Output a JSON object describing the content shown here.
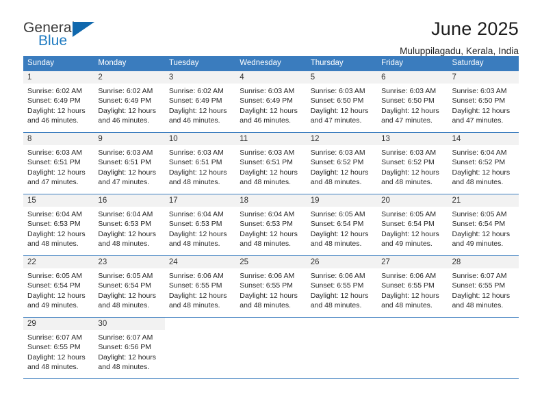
{
  "logo": {
    "primary_text": "General",
    "secondary_text": "Blue",
    "primary_color": "#3a3a3a",
    "secondary_color": "#1f7bc1",
    "triangle_color": "#1068ad",
    "icon": "triangle-icon"
  },
  "header": {
    "title": "June 2025",
    "subtitle": "Muluppilagadu, Kerala, India"
  },
  "theme": {
    "header_row_bg": "#3a7cbe",
    "header_row_text": "#ffffff",
    "row_separator": "#3a7cbe",
    "day_band_bg": "#f2f2f2",
    "body_text": "#262626"
  },
  "calendar": {
    "weekdays": [
      "Sunday",
      "Monday",
      "Tuesday",
      "Wednesday",
      "Thursday",
      "Friday",
      "Saturday"
    ],
    "weeks": [
      [
        {
          "day": "1",
          "sunrise": "Sunrise: 6:02 AM",
          "sunset": "Sunset: 6:49 PM",
          "daylight_line1": "Daylight: 12 hours",
          "daylight_line2": "and 46 minutes."
        },
        {
          "day": "2",
          "sunrise": "Sunrise: 6:02 AM",
          "sunset": "Sunset: 6:49 PM",
          "daylight_line1": "Daylight: 12 hours",
          "daylight_line2": "and 46 minutes."
        },
        {
          "day": "3",
          "sunrise": "Sunrise: 6:02 AM",
          "sunset": "Sunset: 6:49 PM",
          "daylight_line1": "Daylight: 12 hours",
          "daylight_line2": "and 46 minutes."
        },
        {
          "day": "4",
          "sunrise": "Sunrise: 6:03 AM",
          "sunset": "Sunset: 6:49 PM",
          "daylight_line1": "Daylight: 12 hours",
          "daylight_line2": "and 46 minutes."
        },
        {
          "day": "5",
          "sunrise": "Sunrise: 6:03 AM",
          "sunset": "Sunset: 6:50 PM",
          "daylight_line1": "Daylight: 12 hours",
          "daylight_line2": "and 47 minutes."
        },
        {
          "day": "6",
          "sunrise": "Sunrise: 6:03 AM",
          "sunset": "Sunset: 6:50 PM",
          "daylight_line1": "Daylight: 12 hours",
          "daylight_line2": "and 47 minutes."
        },
        {
          "day": "7",
          "sunrise": "Sunrise: 6:03 AM",
          "sunset": "Sunset: 6:50 PM",
          "daylight_line1": "Daylight: 12 hours",
          "daylight_line2": "and 47 minutes."
        }
      ],
      [
        {
          "day": "8",
          "sunrise": "Sunrise: 6:03 AM",
          "sunset": "Sunset: 6:51 PM",
          "daylight_line1": "Daylight: 12 hours",
          "daylight_line2": "and 47 minutes."
        },
        {
          "day": "9",
          "sunrise": "Sunrise: 6:03 AM",
          "sunset": "Sunset: 6:51 PM",
          "daylight_line1": "Daylight: 12 hours",
          "daylight_line2": "and 47 minutes."
        },
        {
          "day": "10",
          "sunrise": "Sunrise: 6:03 AM",
          "sunset": "Sunset: 6:51 PM",
          "daylight_line1": "Daylight: 12 hours",
          "daylight_line2": "and 48 minutes."
        },
        {
          "day": "11",
          "sunrise": "Sunrise: 6:03 AM",
          "sunset": "Sunset: 6:51 PM",
          "daylight_line1": "Daylight: 12 hours",
          "daylight_line2": "and 48 minutes."
        },
        {
          "day": "12",
          "sunrise": "Sunrise: 6:03 AM",
          "sunset": "Sunset: 6:52 PM",
          "daylight_line1": "Daylight: 12 hours",
          "daylight_line2": "and 48 minutes."
        },
        {
          "day": "13",
          "sunrise": "Sunrise: 6:03 AM",
          "sunset": "Sunset: 6:52 PM",
          "daylight_line1": "Daylight: 12 hours",
          "daylight_line2": "and 48 minutes."
        },
        {
          "day": "14",
          "sunrise": "Sunrise: 6:04 AM",
          "sunset": "Sunset: 6:52 PM",
          "daylight_line1": "Daylight: 12 hours",
          "daylight_line2": "and 48 minutes."
        }
      ],
      [
        {
          "day": "15",
          "sunrise": "Sunrise: 6:04 AM",
          "sunset": "Sunset: 6:53 PM",
          "daylight_line1": "Daylight: 12 hours",
          "daylight_line2": "and 48 minutes."
        },
        {
          "day": "16",
          "sunrise": "Sunrise: 6:04 AM",
          "sunset": "Sunset: 6:53 PM",
          "daylight_line1": "Daylight: 12 hours",
          "daylight_line2": "and 48 minutes."
        },
        {
          "day": "17",
          "sunrise": "Sunrise: 6:04 AM",
          "sunset": "Sunset: 6:53 PM",
          "daylight_line1": "Daylight: 12 hours",
          "daylight_line2": "and 48 minutes."
        },
        {
          "day": "18",
          "sunrise": "Sunrise: 6:04 AM",
          "sunset": "Sunset: 6:53 PM",
          "daylight_line1": "Daylight: 12 hours",
          "daylight_line2": "and 48 minutes."
        },
        {
          "day": "19",
          "sunrise": "Sunrise: 6:05 AM",
          "sunset": "Sunset: 6:54 PM",
          "daylight_line1": "Daylight: 12 hours",
          "daylight_line2": "and 48 minutes."
        },
        {
          "day": "20",
          "sunrise": "Sunrise: 6:05 AM",
          "sunset": "Sunset: 6:54 PM",
          "daylight_line1": "Daylight: 12 hours",
          "daylight_line2": "and 49 minutes."
        },
        {
          "day": "21",
          "sunrise": "Sunrise: 6:05 AM",
          "sunset": "Sunset: 6:54 PM",
          "daylight_line1": "Daylight: 12 hours",
          "daylight_line2": "and 49 minutes."
        }
      ],
      [
        {
          "day": "22",
          "sunrise": "Sunrise: 6:05 AM",
          "sunset": "Sunset: 6:54 PM",
          "daylight_line1": "Daylight: 12 hours",
          "daylight_line2": "and 49 minutes."
        },
        {
          "day": "23",
          "sunrise": "Sunrise: 6:05 AM",
          "sunset": "Sunset: 6:54 PM",
          "daylight_line1": "Daylight: 12 hours",
          "daylight_line2": "and 48 minutes."
        },
        {
          "day": "24",
          "sunrise": "Sunrise: 6:06 AM",
          "sunset": "Sunset: 6:55 PM",
          "daylight_line1": "Daylight: 12 hours",
          "daylight_line2": "and 48 minutes."
        },
        {
          "day": "25",
          "sunrise": "Sunrise: 6:06 AM",
          "sunset": "Sunset: 6:55 PM",
          "daylight_line1": "Daylight: 12 hours",
          "daylight_line2": "and 48 minutes."
        },
        {
          "day": "26",
          "sunrise": "Sunrise: 6:06 AM",
          "sunset": "Sunset: 6:55 PM",
          "daylight_line1": "Daylight: 12 hours",
          "daylight_line2": "and 48 minutes."
        },
        {
          "day": "27",
          "sunrise": "Sunrise: 6:06 AM",
          "sunset": "Sunset: 6:55 PM",
          "daylight_line1": "Daylight: 12 hours",
          "daylight_line2": "and 48 minutes."
        },
        {
          "day": "28",
          "sunrise": "Sunrise: 6:07 AM",
          "sunset": "Sunset: 6:55 PM",
          "daylight_line1": "Daylight: 12 hours",
          "daylight_line2": "and 48 minutes."
        }
      ],
      [
        {
          "day": "29",
          "sunrise": "Sunrise: 6:07 AM",
          "sunset": "Sunset: 6:55 PM",
          "daylight_line1": "Daylight: 12 hours",
          "daylight_line2": "and 48 minutes."
        },
        {
          "day": "30",
          "sunrise": "Sunrise: 6:07 AM",
          "sunset": "Sunset: 6:56 PM",
          "daylight_line1": "Daylight: 12 hours",
          "daylight_line2": "and 48 minutes."
        },
        {
          "day": "",
          "sunrise": "",
          "sunset": "",
          "daylight_line1": "",
          "daylight_line2": ""
        },
        {
          "day": "",
          "sunrise": "",
          "sunset": "",
          "daylight_line1": "",
          "daylight_line2": ""
        },
        {
          "day": "",
          "sunrise": "",
          "sunset": "",
          "daylight_line1": "",
          "daylight_line2": ""
        },
        {
          "day": "",
          "sunrise": "",
          "sunset": "",
          "daylight_line1": "",
          "daylight_line2": ""
        },
        {
          "day": "",
          "sunrise": "",
          "sunset": "",
          "daylight_line1": "",
          "daylight_line2": ""
        }
      ]
    ]
  }
}
